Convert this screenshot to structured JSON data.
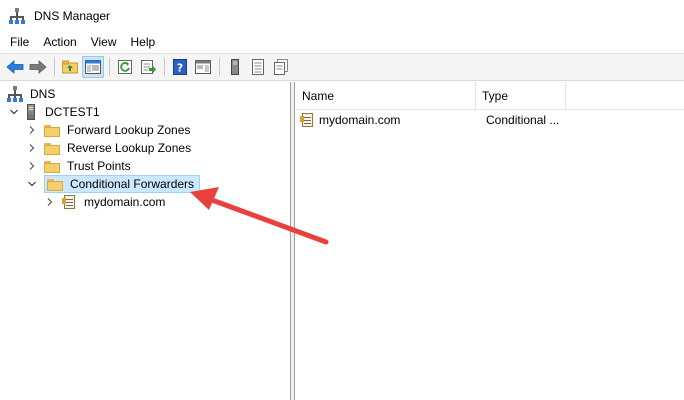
{
  "window": {
    "title": "DNS Manager"
  },
  "menu": {
    "items": [
      "File",
      "Action",
      "View",
      "Help"
    ]
  },
  "tree": {
    "root": {
      "label": "DNS",
      "icon": "dns-manager-icon"
    },
    "server": {
      "label": "DCTEST1",
      "expanded": true,
      "icon": "server-icon"
    },
    "nodes": [
      {
        "label": "Forward Lookup Zones",
        "expanded": false,
        "icon": "folder-icon"
      },
      {
        "label": "Reverse Lookup Zones",
        "expanded": false,
        "icon": "folder-icon"
      },
      {
        "label": "Trust Points",
        "expanded": false,
        "icon": "folder-icon"
      },
      {
        "label": "Conditional Forwarders",
        "expanded": true,
        "selected": true,
        "icon": "folder-icon"
      }
    ],
    "child": {
      "label": "mydomain.com",
      "expanded": false,
      "icon": "zone-icon"
    }
  },
  "list": {
    "columns": [
      "Name",
      "Type"
    ],
    "rows": [
      {
        "name": "mydomain.com",
        "type": "Conditional ..."
      }
    ]
  },
  "colors": {
    "selection_bg": "#cce8ff",
    "selection_border": "#99d1ff",
    "annotation_arrow": "#e8413c",
    "folder": "#f5cf6b"
  }
}
